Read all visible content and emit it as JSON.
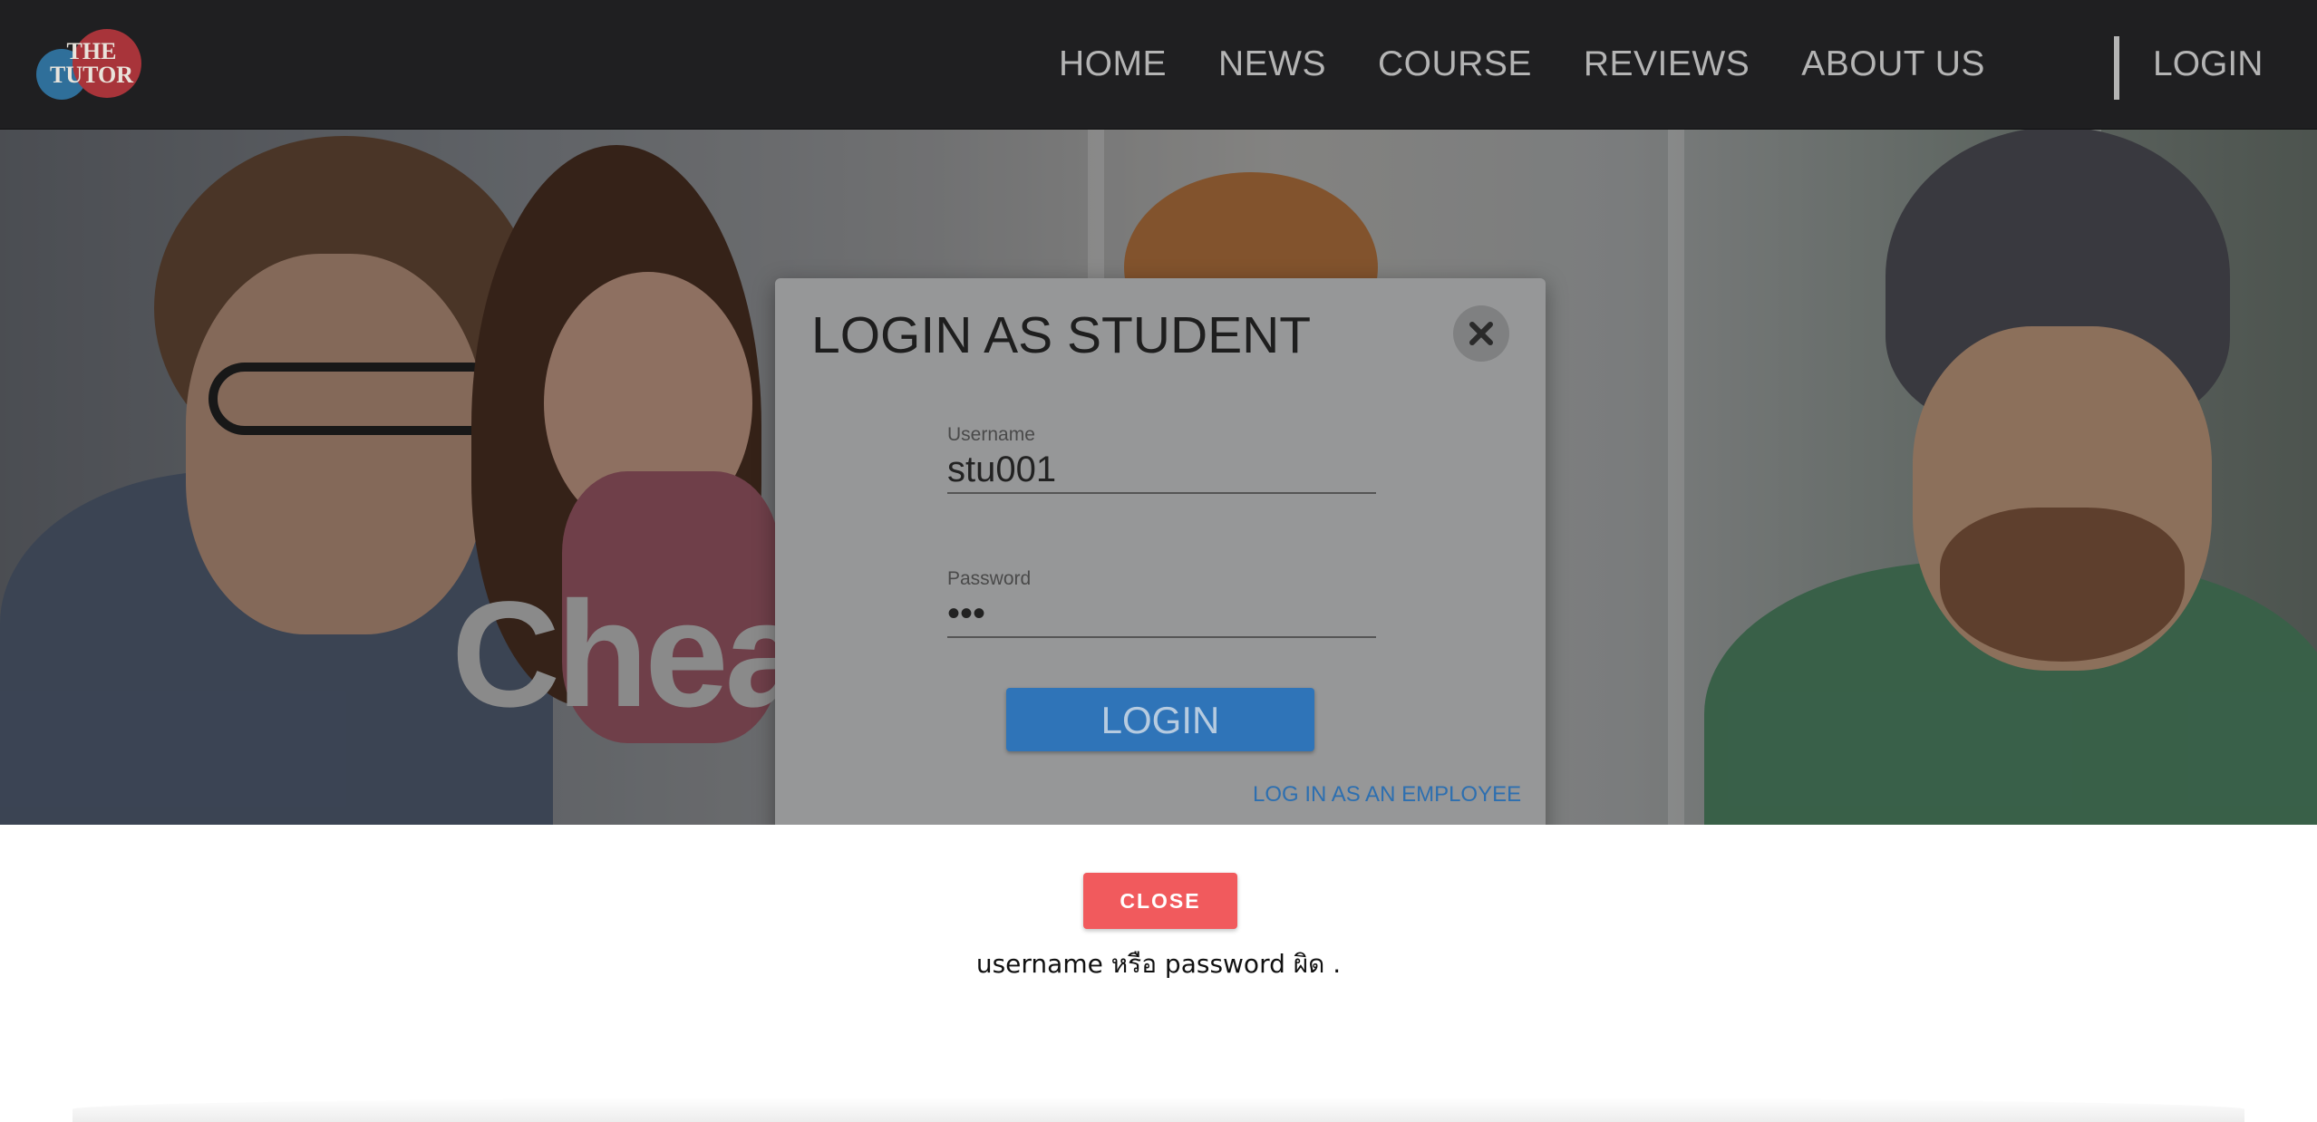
{
  "navbar": {
    "logo_text_line1": "THE",
    "logo_text_line2": "TUTOR",
    "links": [
      {
        "label": "HOME"
      },
      {
        "label": "NEWS"
      },
      {
        "label": "COURSE"
      },
      {
        "label": "REVIEWS"
      },
      {
        "label": "ABOUT US"
      }
    ],
    "login_label": "LOGIN",
    "colors": {
      "background": "#1f1f21",
      "text": "#b4b4b4"
    }
  },
  "hero": {
    "title_visible": "Chea"
  },
  "login_modal": {
    "title": "LOGIN AS STUDENT",
    "close_icon": "close-x-icon",
    "username": {
      "label": "Username",
      "value": "stu001"
    },
    "password": {
      "label": "Password",
      "value": "•••"
    },
    "login_button": "LOGIN",
    "employee_link": "LOG IN AS AN EMPLOYEE",
    "colors": {
      "button": "#2f74b8",
      "link": "#2d6fb0"
    }
  },
  "notification": {
    "close_button": "CLOSE",
    "message": "username หรือ password ผิด .",
    "colors": {
      "button": "#f15a5d"
    }
  }
}
